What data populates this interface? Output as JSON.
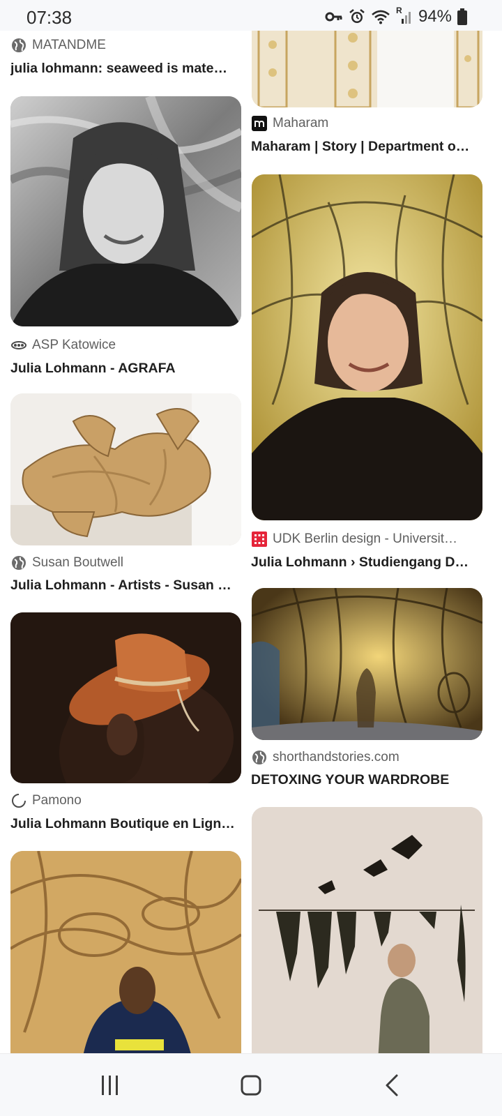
{
  "status_bar": {
    "time": "07:38",
    "icons": [
      "key-icon",
      "alarm-icon",
      "wifi-icon",
      "signal-icon",
      "battery-icon"
    ],
    "roaming_mark": "R",
    "battery_percent": "94%"
  },
  "results": {
    "left": [
      {
        "source": "MATANDME",
        "favicon": "globe-icon",
        "title": "julia lohmann: seaweed is mate…"
      },
      {
        "source": "ASP Katowice",
        "favicon": "asp-logo-icon",
        "title": "Julia Lohmann - AGRAFA",
        "image": "portrait-black-white"
      },
      {
        "source": "Susan Boutwell",
        "favicon": "globe-icon",
        "title": "Julia Lohmann - Artists - Susan …",
        "image": "seaweed-sculpture"
      },
      {
        "source": "Pamono",
        "favicon": "pamono-logo-icon",
        "title": "Julia Lohmann Boutique en Lign…",
        "image": "leather-hat-model"
      },
      {
        "image": "seaweed-pavilion-back-view"
      }
    ],
    "right": [
      {
        "source": "Maharam",
        "favicon": "maharam-logo-icon",
        "title": "Maharam | Story | Department o…",
        "image": "lattice-panels"
      },
      {
        "source": "UDK Berlin design - Universit…",
        "favicon": "udk-logo-icon",
        "title": "Julia Lohmann › Studiengang D…",
        "image": "portrait-seaweed-background"
      },
      {
        "source": "shorthandstories.com",
        "favicon": "globe-icon",
        "title": "DETOXING YOUR WARDROBE",
        "image": "seaweed-pavilion-interior"
      },
      {
        "image": "gallery-seaweed-installation"
      }
    ]
  },
  "nav_bar": {
    "buttons": [
      "recent-apps-button",
      "home-button",
      "back-button"
    ]
  },
  "colors": {
    "bar_background": "#f7f8fa",
    "text_primary": "#1f1f1f",
    "text_secondary": "#5f5f5f"
  }
}
